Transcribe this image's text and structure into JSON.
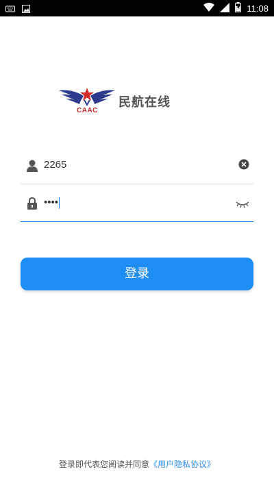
{
  "status_bar": {
    "time": "11:08",
    "left_icons": [
      "keyboard-icon",
      "image-icon"
    ],
    "right_icons": [
      "wifi-icon",
      "signal-icon",
      "battery-icon"
    ]
  },
  "logo": {
    "badge_text": "CAAC",
    "app_name": "民航在线"
  },
  "username": {
    "value": "2265",
    "icon": "user-icon",
    "clear_icon": "clear-icon"
  },
  "password": {
    "value": "••••",
    "icon": "lock-icon",
    "toggle_icon": "eye-closed-icon"
  },
  "login_button": {
    "label": "登录"
  },
  "agreement": {
    "prefix": "登录即代表您阅读并同意",
    "link": "《用户隐私协议》"
  },
  "colors": {
    "accent": "#1e8ef5",
    "caac_blue": "#2b3a8c",
    "caac_red": "#d32a2a"
  }
}
